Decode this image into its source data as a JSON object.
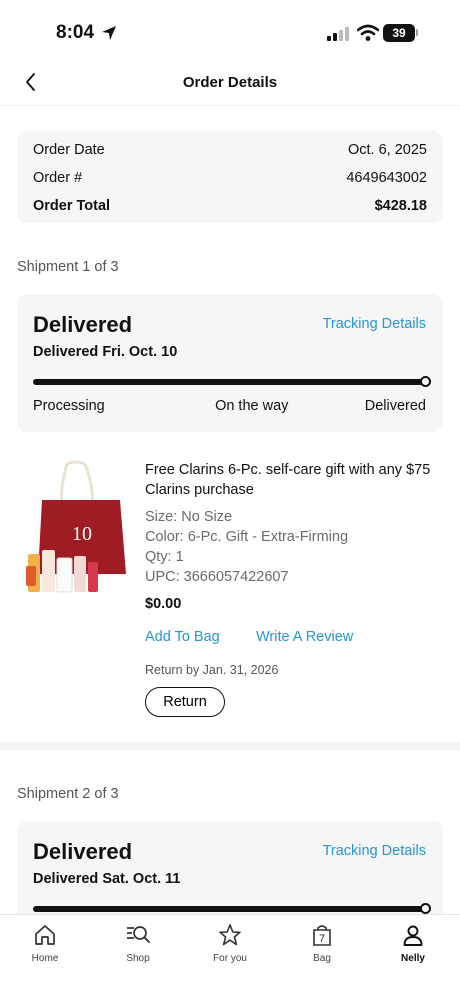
{
  "status_bar": {
    "time": "8:04",
    "battery": "39"
  },
  "header": {
    "title": "Order Details"
  },
  "summary": {
    "rows": [
      {
        "label": "Order Date",
        "value": "Oct. 6, 2025"
      },
      {
        "label": "Order #",
        "value": "4649643002"
      },
      {
        "label": "Order Total",
        "value": "$428.18"
      }
    ]
  },
  "shipments": [
    {
      "label": "Shipment 1 of 3",
      "status": "Delivered",
      "tracking_link": "Tracking Details",
      "delivered_date": "Delivered Fri. Oct. 10",
      "progress": 1.0,
      "steps": [
        "Processing",
        "On the way",
        "Delivered"
      ],
      "item": {
        "name": "Free Clarins 6-Pc. self-care gift with any $75 Clarins purchase",
        "size": "Size: No Size",
        "color": "Color: 6-Pc. Gift - Extra-Firming",
        "qty": "Qty: 1",
        "upc": "UPC: 3666057422607",
        "price": "$0.00",
        "add_to_bag": "Add To Bag",
        "write_review": "Write A Review",
        "return_by": "Return by Jan. 31, 2026",
        "return_button": "Return",
        "bag_text": "10"
      }
    },
    {
      "label": "Shipment 2 of 3",
      "status": "Delivered",
      "tracking_link": "Tracking Details",
      "delivered_date": "Delivered Sat. Oct. 11",
      "progress": 1.0
    }
  ],
  "tabs": [
    {
      "label": "Home",
      "icon": "home-icon"
    },
    {
      "label": "Shop",
      "icon": "shop-search-icon"
    },
    {
      "label": "For you",
      "icon": "star-icon"
    },
    {
      "label": "Bag",
      "icon": "bag-icon",
      "badge": "7"
    },
    {
      "label": "Nelly",
      "icon": "person-icon",
      "active": true
    }
  ],
  "colors": {
    "link": "#2596d6",
    "bag_red": "#a01c25",
    "card_bg": "#f6f6f6"
  }
}
